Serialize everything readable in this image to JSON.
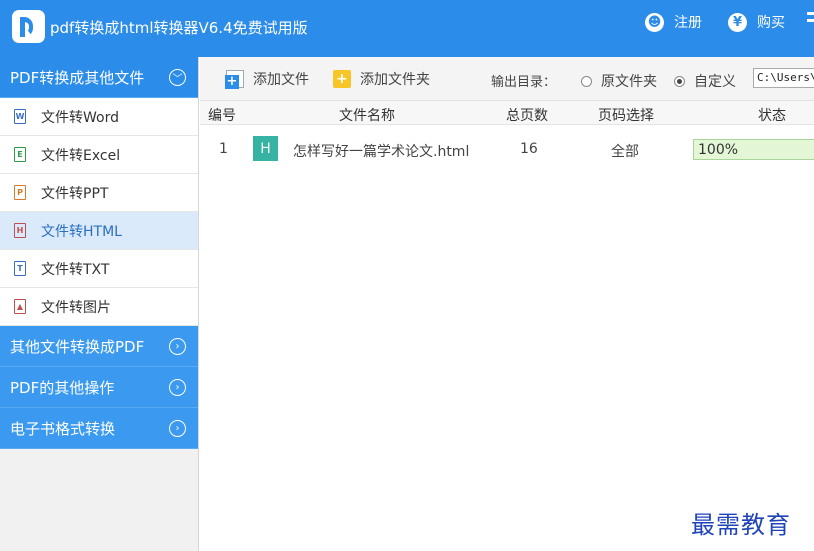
{
  "window": {
    "title": "pdf转换成html转换器V6.4免费试用版",
    "register_label": "注册",
    "register_icon": "user-icon",
    "buy_label": "购买",
    "buy_icon": "yen-icon",
    "brand_color": "#2b8cea"
  },
  "sidebar": {
    "groups": [
      {
        "label": "PDF转换成其他文件",
        "expanded": true,
        "items": [
          {
            "label": "文件转Word",
            "icon": "word-file-icon",
            "glyph": "W"
          },
          {
            "label": "文件转Excel",
            "icon": "excel-file-icon",
            "glyph": "E"
          },
          {
            "label": "文件转PPT",
            "icon": "ppt-file-icon",
            "glyph": "P"
          },
          {
            "label": "文件转HTML",
            "icon": "html-file-icon",
            "glyph": "H",
            "selected": true
          },
          {
            "label": "文件转TXT",
            "icon": "txt-file-icon",
            "glyph": "T"
          },
          {
            "label": "文件转图片",
            "icon": "image-file-icon",
            "glyph": "▲"
          }
        ]
      },
      {
        "label": "其他文件转换成PDF",
        "expanded": false
      },
      {
        "label": "PDF的其他操作",
        "expanded": false
      },
      {
        "label": "电子书格式转换",
        "expanded": false
      }
    ]
  },
  "toolbar": {
    "add_file_label": "添加文件",
    "add_folder_label": "添加文件夹",
    "output_dir_label": "输出目录：",
    "option_original": "原文件夹",
    "option_custom": "自定义",
    "selected_option": "custom",
    "path_value": "C:\\Users\\"
  },
  "table": {
    "headers": {
      "number": "编号",
      "file_name": "文件名称",
      "total_pages": "总页数",
      "page_range": "页码选择",
      "status": "状态"
    },
    "rows": [
      {
        "number": "1",
        "type_badge": "H",
        "file_name": "怎样写好一篇学术论文.html",
        "total_pages": "16",
        "page_range": "全部",
        "progress_text": "100%",
        "progress": 1.0
      }
    ]
  },
  "watermark": {
    "text": "最需教育",
    "color": "#1f44b8"
  }
}
